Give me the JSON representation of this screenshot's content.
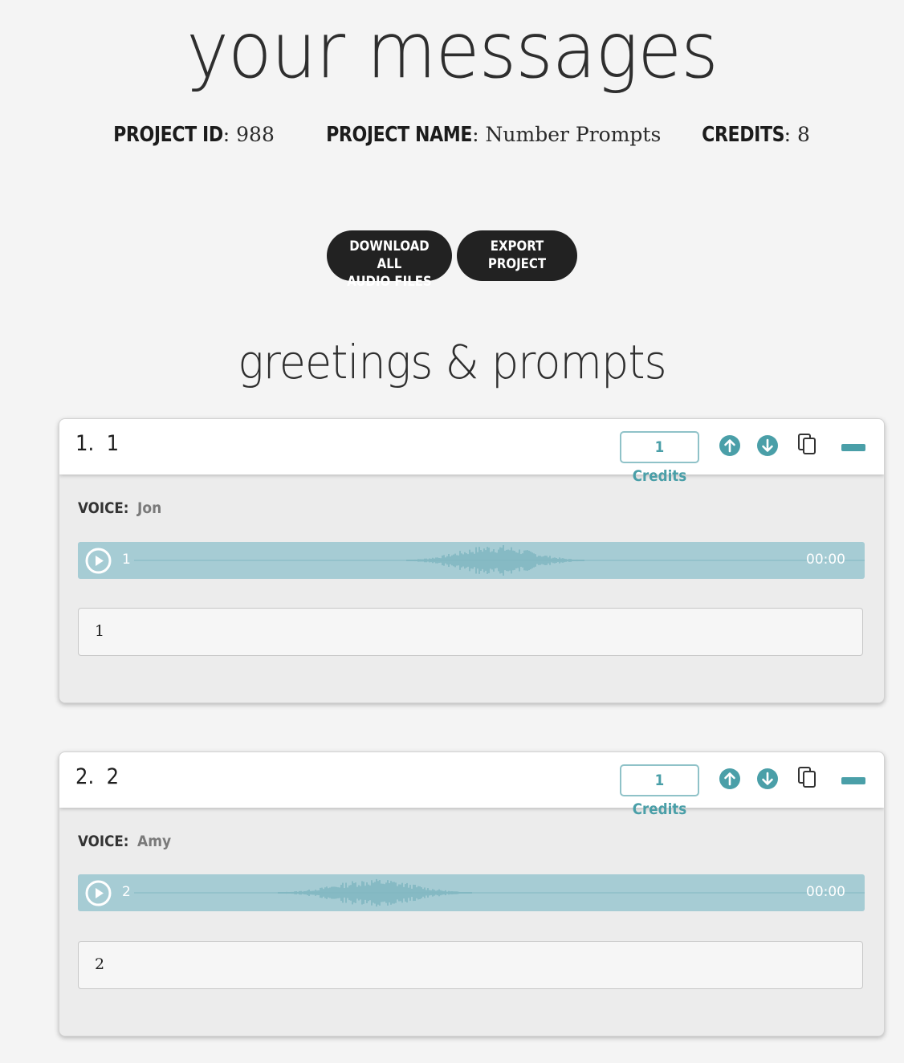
{
  "header": {
    "title": "your messages",
    "project_id_label": "PROJECT ID",
    "project_id": "988",
    "project_name_label": "PROJECT NAME",
    "project_name": "Number Prompts",
    "credits_label": "CREDITS",
    "credits": "8"
  },
  "actions": {
    "download_line1": "DOWNLOAD ALL",
    "download_line2": "AUDIO FILES",
    "export_line1": "EXPORT",
    "export_line2": "PROJECT"
  },
  "section": {
    "title": "greetings & prompts"
  },
  "colors": {
    "accent": "#4a9fa8",
    "player_bg": "#a6ccd4",
    "button_dark": "#222222"
  },
  "messages": [
    {
      "title": "1.  1",
      "credits_badge": "1 Credits",
      "voice_label": "VOICE:",
      "voice": "Jon",
      "track_label": "1",
      "time": "00:00",
      "text": "1"
    },
    {
      "title": "2.  2",
      "credits_badge": "1 Credits",
      "voice_label": "VOICE:",
      "voice": "Amy",
      "track_label": "2",
      "time": "00:00",
      "text": "2"
    }
  ]
}
